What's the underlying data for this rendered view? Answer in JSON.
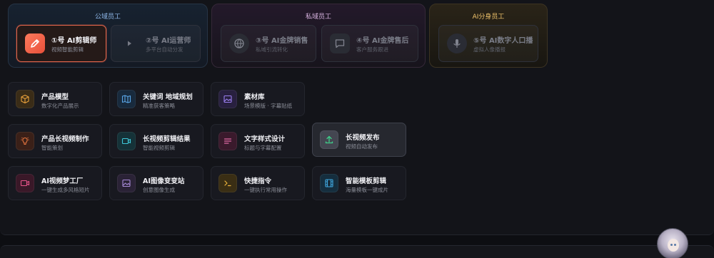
{
  "groups": {
    "public": {
      "title": "公域员工",
      "employees": [
        {
          "name": "①号 AI剪辑师",
          "sub": "视频智能剪辑",
          "icon": "pen-icon",
          "active": true
        },
        {
          "name": "②号 AI运营师",
          "sub": "多平台自动分发",
          "icon": "play-icon",
          "active": false
        }
      ]
    },
    "private": {
      "title": "私域员工",
      "employees": [
        {
          "name": "③号 AI金牌销售",
          "sub": "私域引流转化",
          "icon": "globe-icon"
        },
        {
          "name": "④号 AI金牌售后",
          "sub": "客户服务跟进",
          "icon": "chat-icon"
        }
      ]
    },
    "clone": {
      "title": "AI分身员工",
      "employees": [
        {
          "name": "⑤号 AI数字人口播",
          "sub": "虚拟人像播报",
          "icon": "mic-icon"
        }
      ]
    }
  },
  "tools": [
    {
      "title": "产品模型",
      "desc": "数字化产品展示",
      "icon": "cube-icon",
      "color": "#e9a13b"
    },
    {
      "title": "关键词 地域规划",
      "desc": "精准获客策略",
      "icon": "map-icon",
      "color": "#5aa6e8"
    },
    {
      "title": "素材库",
      "desc": "场景模版 · 字幕贴纸",
      "icon": "image-icon",
      "color": "#9b7ff0"
    },
    {
      "title": "产品长视频制作",
      "desc": "智能策划",
      "icon": "bulb-icon",
      "color": "#e8763f"
    },
    {
      "title": "长视频剪辑结果",
      "desc": "智能视频剪辑",
      "icon": "video-icon",
      "color": "#3fc7d8"
    },
    {
      "title": "文字样式设计",
      "desc": "标题与字幕配置",
      "icon": "text-lines-icon",
      "color": "#e06aa5"
    },
    {
      "title": "长视频发布",
      "desc": "视频自动发布",
      "icon": "upload-icon",
      "color": "#3fd08a"
    },
    {
      "title": "AI视频梦工厂",
      "desc": "一键生成多风格短片",
      "icon": "camera-icon",
      "color": "#e8558a"
    },
    {
      "title": "AI图像变变站",
      "desc": "创意图像生成",
      "icon": "picture-icon",
      "color": "#a88ad8"
    },
    {
      "title": "快捷指令",
      "desc": "一键执行常用操作",
      "icon": "terminal-icon",
      "color": "#e9b23b"
    },
    {
      "title": "智能模板剪辑",
      "desc": "海量模板一键成片",
      "icon": "film-icon",
      "color": "#3fa8e0"
    }
  ],
  "assistant": {
    "icon": "avatar-icon"
  }
}
